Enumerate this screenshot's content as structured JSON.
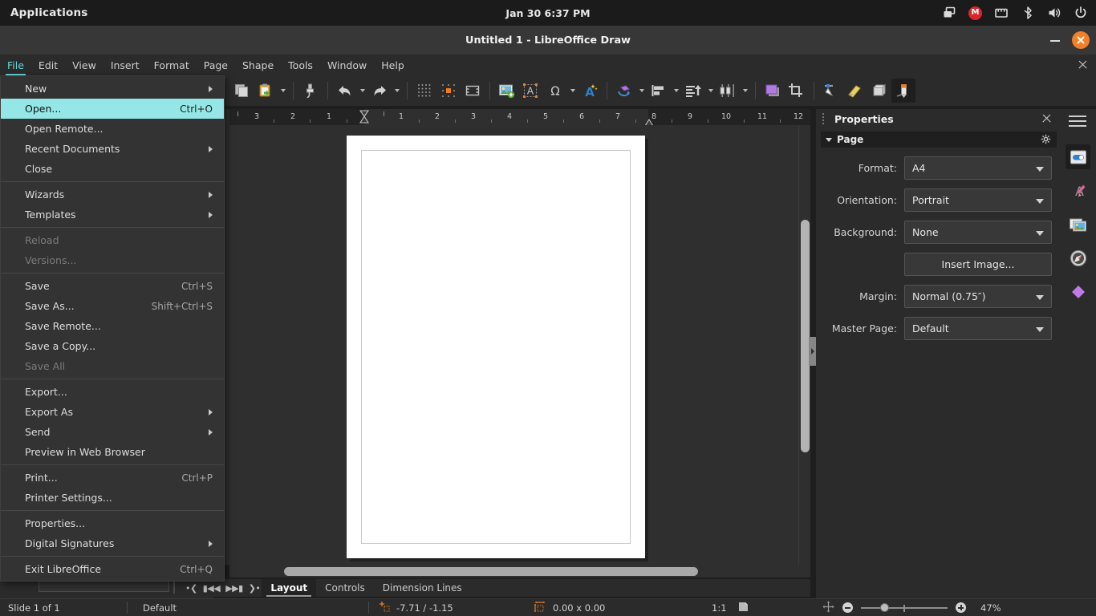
{
  "system_bar": {
    "applications_label": "Applications",
    "clock": "Jan 30  6:37 PM",
    "tray_icons": [
      "window-switcher-icon",
      "mega-icon",
      "ethernet-icon",
      "bluetooth-icon",
      "volume-icon",
      "power-icon"
    ],
    "mega_badge": "M"
  },
  "window": {
    "title": "Untitled 1 - LibreOffice Draw",
    "minimize_label": "Minimize",
    "close_label": "Close",
    "close_color": "#f0802a"
  },
  "menubar": {
    "items": [
      {
        "label": "File",
        "active": true
      },
      {
        "label": "Edit",
        "active": false
      },
      {
        "label": "View",
        "active": false
      },
      {
        "label": "Insert",
        "active": false
      },
      {
        "label": "Format",
        "active": false
      },
      {
        "label": "Page",
        "active": false
      },
      {
        "label": "Shape",
        "active": false
      },
      {
        "label": "Tools",
        "active": false
      },
      {
        "label": "Window",
        "active": false
      },
      {
        "label": "Help",
        "active": false
      }
    ],
    "accent_color": "#64d8d8",
    "close_doc_label": "Close Document"
  },
  "file_menu": {
    "items": [
      {
        "label": "New",
        "shortcut": "",
        "submenu": true,
        "disabled": false,
        "highlighted": false,
        "separator_after": false
      },
      {
        "label": "Open...",
        "shortcut": "Ctrl+O",
        "submenu": false,
        "disabled": false,
        "highlighted": true,
        "separator_after": false
      },
      {
        "label": "Open Remote...",
        "shortcut": "",
        "submenu": false,
        "disabled": false,
        "highlighted": false,
        "separator_after": false
      },
      {
        "label": "Recent Documents",
        "shortcut": "",
        "submenu": true,
        "disabled": false,
        "highlighted": false,
        "separator_after": false
      },
      {
        "label": "Close",
        "shortcut": "",
        "submenu": false,
        "disabled": false,
        "highlighted": false,
        "separator_after": true
      },
      {
        "label": "Wizards",
        "shortcut": "",
        "submenu": true,
        "disabled": false,
        "highlighted": false,
        "separator_after": false
      },
      {
        "label": "Templates",
        "shortcut": "",
        "submenu": true,
        "disabled": false,
        "highlighted": false,
        "separator_after": true
      },
      {
        "label": "Reload",
        "shortcut": "",
        "submenu": false,
        "disabled": true,
        "highlighted": false,
        "separator_after": false
      },
      {
        "label": "Versions...",
        "shortcut": "",
        "submenu": false,
        "disabled": true,
        "highlighted": false,
        "separator_after": true
      },
      {
        "label": "Save",
        "shortcut": "Ctrl+S",
        "submenu": false,
        "disabled": false,
        "highlighted": false,
        "separator_after": false
      },
      {
        "label": "Save As...",
        "shortcut": "Shift+Ctrl+S",
        "submenu": false,
        "disabled": false,
        "highlighted": false,
        "separator_after": false
      },
      {
        "label": "Save Remote...",
        "shortcut": "",
        "submenu": false,
        "disabled": false,
        "highlighted": false,
        "separator_after": false
      },
      {
        "label": "Save a Copy...",
        "shortcut": "",
        "submenu": false,
        "disabled": false,
        "highlighted": false,
        "separator_after": false
      },
      {
        "label": "Save All",
        "shortcut": "",
        "submenu": false,
        "disabled": true,
        "highlighted": false,
        "separator_after": true
      },
      {
        "label": "Export...",
        "shortcut": "",
        "submenu": false,
        "disabled": false,
        "highlighted": false,
        "separator_after": false
      },
      {
        "label": "Export As",
        "shortcut": "",
        "submenu": true,
        "disabled": false,
        "highlighted": false,
        "separator_after": false
      },
      {
        "label": "Send",
        "shortcut": "",
        "submenu": true,
        "disabled": false,
        "highlighted": false,
        "separator_after": false
      },
      {
        "label": "Preview in Web Browser",
        "shortcut": "",
        "submenu": false,
        "disabled": false,
        "highlighted": false,
        "separator_after": true
      },
      {
        "label": "Print...",
        "shortcut": "Ctrl+P",
        "submenu": false,
        "disabled": false,
        "highlighted": false,
        "separator_after": false
      },
      {
        "label": "Printer Settings...",
        "shortcut": "",
        "submenu": false,
        "disabled": false,
        "highlighted": false,
        "separator_after": true
      },
      {
        "label": "Properties...",
        "shortcut": "",
        "submenu": false,
        "disabled": false,
        "highlighted": false,
        "separator_after": false
      },
      {
        "label": "Digital Signatures",
        "shortcut": "",
        "submenu": true,
        "disabled": false,
        "highlighted": false,
        "separator_after": true
      },
      {
        "label": "Exit LibreOffice",
        "shortcut": "Ctrl+Q",
        "submenu": false,
        "disabled": false,
        "highlighted": false,
        "separator_after": false
      }
    ],
    "highlight_color": "#95e7e7"
  },
  "toolbar": {
    "buttons": [
      {
        "name": "copy-icon",
        "tip": "Copy"
      },
      {
        "name": "paste-icon",
        "tip": "Paste"
      },
      {
        "name": "paste-dropdown-caret",
        "tip": "Paste Options"
      },
      {
        "name": "clone-formatting-icon",
        "tip": "Clone Formatting"
      },
      {
        "name": "undo-icon",
        "tip": "Undo"
      },
      {
        "name": "undo-dropdown-caret",
        "tip": "Undo History"
      },
      {
        "name": "redo-icon",
        "tip": "Redo"
      },
      {
        "name": "redo-dropdown-caret",
        "tip": "Redo History"
      },
      {
        "name": "display-grid-icon",
        "tip": "Display Grid"
      },
      {
        "name": "snap-to-grid-icon",
        "tip": "Snap to Grid"
      },
      {
        "name": "display-snap-guides-icon",
        "tip": "Helplines While Moving"
      },
      {
        "name": "insert-image-icon",
        "tip": "Insert Image"
      },
      {
        "name": "insert-text-box-icon",
        "tip": "Insert Text Box"
      },
      {
        "name": "insert-special-character-icon",
        "tip": "Insert Special Character"
      },
      {
        "name": "special-character-caret",
        "tip": "Special Character Options"
      },
      {
        "name": "fontwork-icon",
        "tip": "Insert Fontwork Text"
      },
      {
        "name": "transformations-icon",
        "tip": "Transformations"
      },
      {
        "name": "transformations-caret",
        "tip": "Transformations Options"
      },
      {
        "name": "align-objects-icon",
        "tip": "Align Objects"
      },
      {
        "name": "align-objects-caret",
        "tip": "Align Options"
      },
      {
        "name": "arrange-icon",
        "tip": "Arrange"
      },
      {
        "name": "arrange-caret",
        "tip": "Arrange Options"
      },
      {
        "name": "distribute-selection-icon",
        "tip": "Distribute Selection"
      },
      {
        "name": "distribute-caret",
        "tip": "Distribute Options"
      },
      {
        "name": "shadow-icon",
        "tip": "Shadow"
      },
      {
        "name": "crop-image-icon",
        "tip": "Crop Image"
      },
      {
        "name": "filter-icon",
        "tip": "Filter"
      },
      {
        "name": "points-icon",
        "tip": "Points"
      },
      {
        "name": "glue-points-icon",
        "tip": "Glue Points"
      },
      {
        "name": "toggle-extrusion-icon",
        "tip": "Toggle Extrusion"
      },
      {
        "name": "show-draw-functions-icon",
        "tip": "Show Draw Functions",
        "selected": true
      }
    ]
  },
  "ruler": {
    "horizontal_labels": [
      "3",
      "2",
      "1",
      "1",
      "2",
      "3",
      "4",
      "5",
      "6",
      "7",
      "8",
      "9",
      "10",
      "11",
      "12"
    ],
    "unit": "inch"
  },
  "left_dock": {
    "buttons": [
      {
        "name": "stars-shapes-icon"
      },
      {
        "name": "3d-objects-icon"
      }
    ]
  },
  "layer_tabs": {
    "nav": [
      "first-layer-nav",
      "previous-layer-nav",
      "next-layer-nav",
      "last-layer-nav"
    ],
    "tabs": [
      {
        "label": "Layout",
        "active": true
      },
      {
        "label": "Controls",
        "active": false
      },
      {
        "label": "Dimension Lines",
        "active": false
      }
    ]
  },
  "status_bar": {
    "slide_info": "Slide 1 of 1",
    "master_page": "Default",
    "cursor_position": "-7.71 / -1.15",
    "object_size": "0.00 x 0.00",
    "zoom_ratio": "1:1",
    "zoom_percent": "47%",
    "fit_slide_icon": "fit-slide-icon",
    "view_layout_icon": "view-layout-icon"
  },
  "sidebar": {
    "title": "Properties",
    "panel": {
      "name": "Page",
      "expanded": true,
      "rows": [
        {
          "label": "Format:",
          "value": "A4",
          "type": "dropdown"
        },
        {
          "label": "Orientation:",
          "value": "Portrait",
          "type": "dropdown"
        },
        {
          "label": "Background:",
          "value": "None",
          "type": "dropdown"
        },
        {
          "label": "",
          "value": "Insert Image...",
          "type": "button"
        },
        {
          "label": "Margin:",
          "value": "Normal (0.75″)",
          "type": "dropdown"
        },
        {
          "label": "Master Page:",
          "value": "Default",
          "type": "dropdown"
        }
      ]
    },
    "rail": [
      {
        "name": "properties-deck-icon",
        "selected": true
      },
      {
        "name": "styles-deck-icon",
        "selected": false
      },
      {
        "name": "gallery-deck-icon",
        "selected": false
      },
      {
        "name": "navigator-deck-icon",
        "selected": false
      },
      {
        "name": "shapes-deck-icon",
        "selected": false
      }
    ]
  }
}
